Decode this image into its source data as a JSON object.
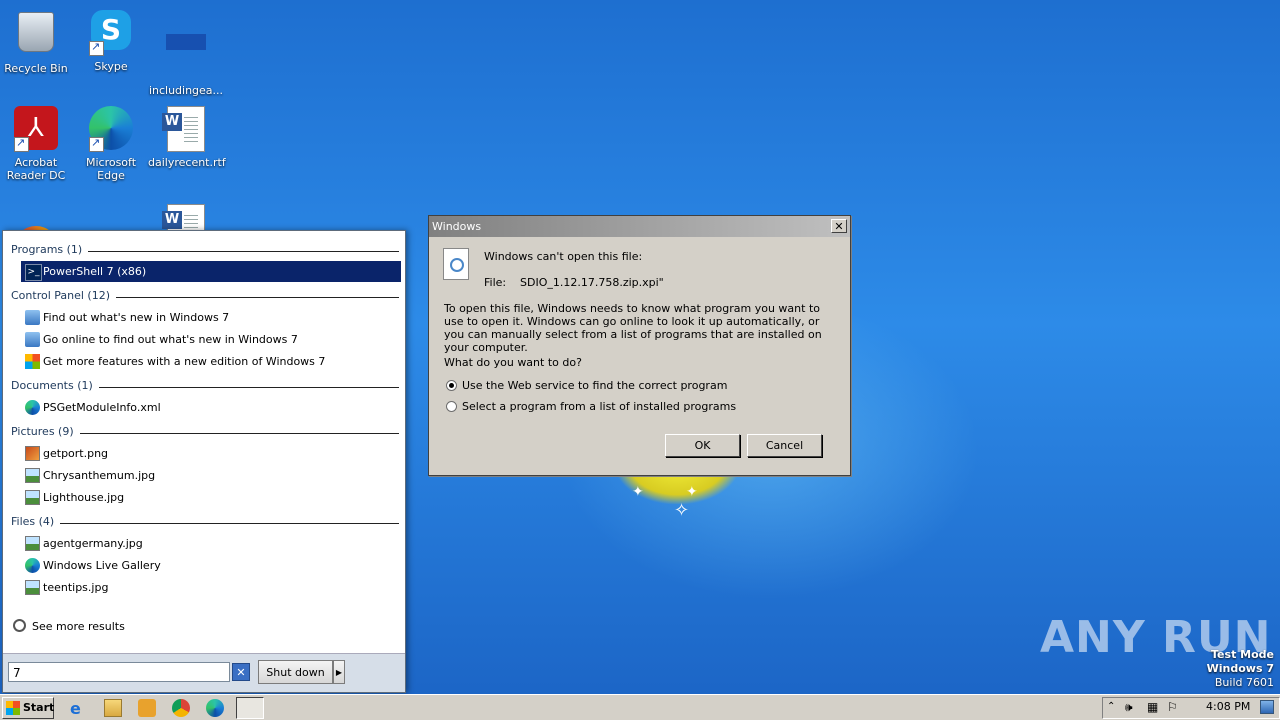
{
  "desktop": {
    "icons": [
      {
        "label": "Recycle Bin",
        "icon": "recycle-bin-icon"
      },
      {
        "label": "Skype",
        "icon": "skype-icon"
      },
      {
        "label": "includingea...",
        "icon": "document-icon"
      },
      {
        "label": "Acrobat Reader DC",
        "icon": "acrobat-icon"
      },
      {
        "label": "Microsoft Edge",
        "icon": "edge-icon"
      },
      {
        "label": "dailyrecent.rtf",
        "icon": "word-document-icon"
      }
    ],
    "watermark": "ANY RUN",
    "test_mode": {
      "line1": "Test Mode",
      "line2": "Windows 7",
      "line3": "Build 7601"
    }
  },
  "start_menu": {
    "sections": [
      {
        "header": "Programs (1)",
        "items": [
          {
            "label": "PowerShell 7 (x86)",
            "icon": "powershell-icon",
            "selected": true
          }
        ]
      },
      {
        "header": "Control Panel (12)",
        "items": [
          {
            "label": "Find out what's new in Windows 7",
            "icon": "control-panel-icon"
          },
          {
            "label": "Go online to find out what's new in Windows 7",
            "icon": "control-panel-icon"
          },
          {
            "label": "Get more features with a new edition of Windows 7",
            "icon": "windows-logo-icon"
          }
        ]
      },
      {
        "header": "Documents (1)",
        "items": [
          {
            "label": "PSGetModuleInfo.xml",
            "icon": "edge-icon"
          }
        ]
      },
      {
        "header": "Pictures (9)",
        "items": [
          {
            "label": "getport.png",
            "icon": "image-icon"
          },
          {
            "label": "Chrysanthemum.jpg",
            "icon": "image-icon"
          },
          {
            "label": "Lighthouse.jpg",
            "icon": "image-icon"
          }
        ]
      },
      {
        "header": "Files (4)",
        "items": [
          {
            "label": "agentgermany.jpg",
            "icon": "image-icon"
          },
          {
            "label": "Windows Live Gallery",
            "icon": "edge-icon"
          },
          {
            "label": "teentips.jpg",
            "icon": "image-icon"
          }
        ]
      }
    ],
    "see_more": "See more results",
    "search_value": "7",
    "shutdown_label": "Shut down"
  },
  "dialog": {
    "title": "Windows",
    "heading": "Windows can't open this file:",
    "file_label": "File:",
    "file_name": "SDIO_1.12.17.758.zip.xpi\"",
    "explanation": "To open this file, Windows needs to know what program you want to use to open it. Windows can go online to look it up automatically, or you can manually select from a list of programs that are installed on your computer.",
    "question": "What do you want to do?",
    "option_web": "Use the Web service to find the correct program",
    "option_list": "Select a program from a list of installed programs",
    "ok": "OK",
    "cancel": "Cancel"
  },
  "taskbar": {
    "start_label": "Start",
    "clock": "4:08 PM"
  }
}
